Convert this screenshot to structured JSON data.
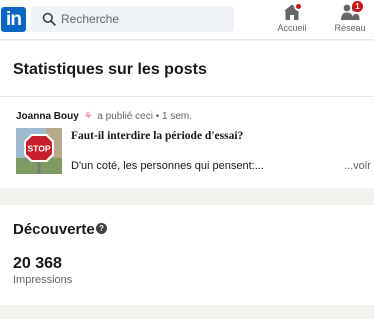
{
  "header": {
    "logo_text": "in",
    "search_placeholder": "Recherche",
    "nav": {
      "home": {
        "label": "Accueil",
        "has_notification_dot": true
      },
      "network": {
        "label": "Réseau",
        "badge": "1"
      }
    }
  },
  "stats": {
    "title": "Statistiques sur les posts",
    "post": {
      "author": "Joanna Bouy",
      "author_suffix": "a publié ceci",
      "time": "• 1 sem.",
      "title": "Faut-il interdire la période d'essai?",
      "excerpt": "D'un coté, les personnes qui pensent:...",
      "see_more": "...voir p",
      "thumbnail_sign": "STOP"
    }
  },
  "discovery": {
    "title": "Découverte",
    "help_icon": "?",
    "impressions_value": "20 368",
    "impressions_label": "Impressions"
  },
  "colors": {
    "brand": "#0a66c2",
    "badge": "#cc1016",
    "background": "#f3f2ef"
  }
}
